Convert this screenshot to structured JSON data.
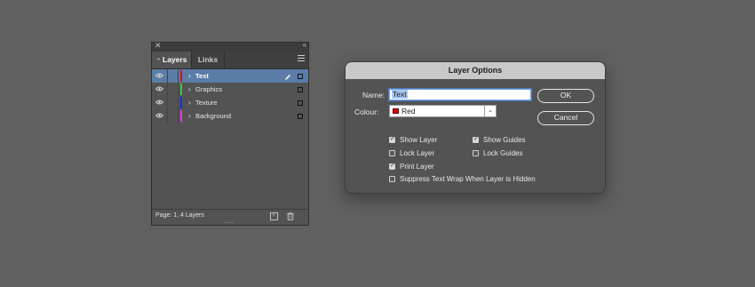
{
  "layers_panel": {
    "tabs": [
      {
        "label": "Layers",
        "active": true
      },
      {
        "label": "Links",
        "active": false
      }
    ],
    "layers": [
      {
        "name": "Text",
        "color": "#d0102a",
        "selected": true
      },
      {
        "name": "Graphics",
        "color": "#3ec93e",
        "selected": false
      },
      {
        "name": "Texture",
        "color": "#1e2bd8",
        "selected": false
      },
      {
        "name": "Background",
        "color": "#e23ce0",
        "selected": false
      }
    ],
    "footer_status": "Page: 1, 4 Layers"
  },
  "dialog": {
    "title": "Layer Options",
    "name_label": "Name:",
    "name_value": "Text",
    "colour_label": "Colour:",
    "colour_value": "Red",
    "colour_swatch": "#d40000",
    "ok_label": "OK",
    "cancel_label": "Cancel",
    "options": {
      "show_layer": {
        "label": "Show Layer",
        "checked": true
      },
      "show_guides": {
        "label": "Show Guides",
        "checked": true
      },
      "lock_layer": {
        "label": "Lock Layer",
        "checked": false
      },
      "lock_guides": {
        "label": "Lock Guides",
        "checked": false
      },
      "print_layer": {
        "label": "Print Layer",
        "checked": true
      },
      "suppress_wrap": {
        "label": "Suppress Text Wrap When Layer is Hidden",
        "checked": false
      }
    }
  }
}
